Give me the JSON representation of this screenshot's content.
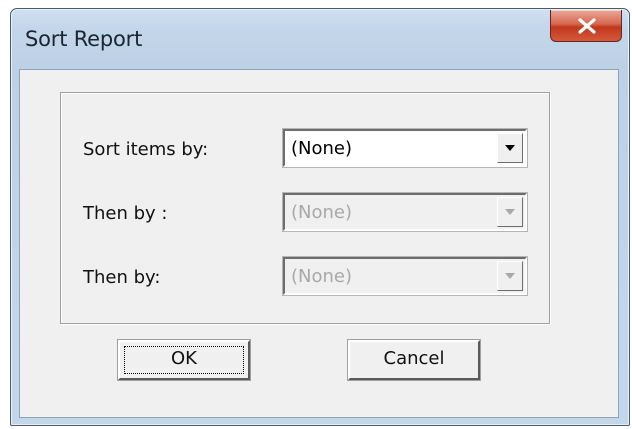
{
  "window": {
    "title": "Sort Report",
    "close_icon": "close-x-icon"
  },
  "sort": {
    "rows": [
      {
        "label": "Sort items by:",
        "value": "(None)",
        "enabled": true
      },
      {
        "label": "Then by :",
        "value": "(None)",
        "enabled": false
      },
      {
        "label": "Then by:",
        "value": "(None)",
        "enabled": false
      }
    ]
  },
  "buttons": {
    "ok": "OK",
    "cancel": "Cancel"
  }
}
